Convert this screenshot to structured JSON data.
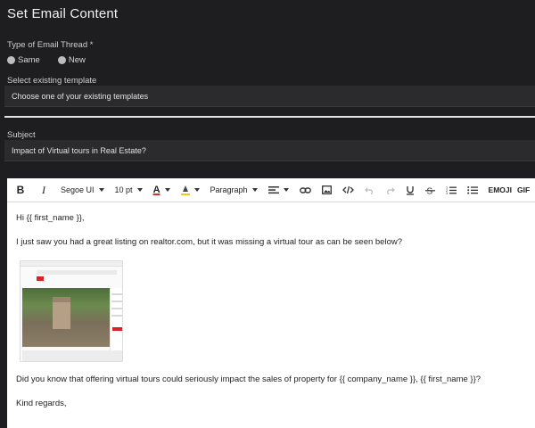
{
  "header": {
    "title": "Set Email Content"
  },
  "thread_type": {
    "label": "Type of Email Thread *",
    "options": [
      "Same",
      "New"
    ]
  },
  "template": {
    "label": "Select existing template",
    "value": "Choose one of your existing templates"
  },
  "subject": {
    "label": "Subject",
    "value": "Impact of Virtual tours in Real Estate?"
  },
  "toolbar": {
    "bold": "B",
    "italic": "I",
    "font": "Segoe UI",
    "size": "10 pt",
    "text_color": "A",
    "block_format": "Paragraph",
    "emoji": "EMOJI",
    "gif": "GIF",
    "icons": [
      "text-color-icon",
      "highlight-icon",
      "align-icon",
      "link-icon",
      "image-icon",
      "code-icon",
      "undo-icon",
      "redo-icon",
      "underline-icon",
      "strikethrough-icon",
      "numbered-list-icon",
      "bullet-list-icon"
    ],
    "colors": {
      "text_color_underline": "#d32f2f",
      "highlight": "#f5c518"
    }
  },
  "body": {
    "greeting": "Hi {{ first_name }},",
    "line1": "I just saw you had a great listing on realtor.com, but it was missing a virtual tour as can be seen below?",
    "line2": "Did you know that offering virtual tours could seriously impact the sales of property for {{ company_name }}, {{ first_name }}?",
    "closing": "Kind regards,"
  },
  "colors": {
    "background": "#1e1e20",
    "field": "#2b2b2e",
    "editor": "#ffffff",
    "accent_red": "#d92228"
  }
}
